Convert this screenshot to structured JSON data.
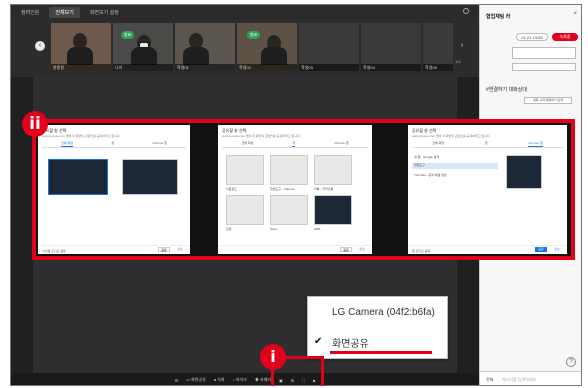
{
  "topbar": {
    "tabs": [
      "참여인원",
      "전체보기",
      "화면보기 설정"
    ],
    "active_tab_index": 1
  },
  "participants": [
    {
      "caption": "한종원",
      "badge": ""
    },
    {
      "caption": "나이",
      "badge": "발표"
    },
    {
      "caption": "학생01",
      "badge": ""
    },
    {
      "caption": "학생02",
      "badge": "발표"
    },
    {
      "caption": "학생03",
      "badge": ""
    },
    {
      "caption": "학생04",
      "badge": ""
    },
    {
      "caption": "학생05",
      "badge": ""
    }
  ],
  "strip_page": "1/4",
  "sidepanel": {
    "title": "협업채팅 라",
    "pill_time": "01:21",
    "pill_time_extra": "13:58",
    "pill_record": "녹화중",
    "section": "#연결하기 대화상대",
    "section_button": "대화 시작 대화하기 단계",
    "input_placeholder": "메시지를 입력하세요",
    "input_prefix": "전체"
  },
  "share_dialogs": [
    {
      "title": "공유할 창 선택",
      "subtitle": "www.remote.com 앱이 이 화면의 콘텐츠를 공유하려고 합니다.",
      "tabs": [
        "전체 화면",
        "창",
        "Chrome 탭"
      ],
      "active_tab": 0,
      "footer_check": "시스템 오디오 공유",
      "share_label": "공유",
      "cancel_label": "취소"
    },
    {
      "title": "공유할 창 선택",
      "subtitle": "www.remote.com 앱이 이 화면의 콘텐츠를 공유하려고 합니다.",
      "tabs": [
        "전체 화면",
        "창",
        "Chrome 탭"
      ],
      "active_tab": 1,
      "window_captions": [
        "다운로드",
        "협업도구 - Chrome",
        "카톡 - 카카오톡",
        "한글",
        "탐색기 수업",
        "Zoom",
        "OBS"
      ],
      "share_label": "공유",
      "cancel_label": "취소"
    },
    {
      "title": "공유할 창 선택",
      "subtitle": "www.remote.com 앱이 이 화면의 콘텐츠를 공유하려고 합니다.",
      "tabs": [
        "전체 화면",
        "창",
        "Chrome 탭"
      ],
      "active_tab": 2,
      "tab_list": [
        "새 탭 - Google 검색",
        "협업도구",
        "YouTube - 공식 채널 영상"
      ],
      "footer_check": "탭 오디오 공유",
      "share_label": "공유",
      "cancel_label": "취소"
    }
  ],
  "camera_menu": {
    "options": [
      "LG Camera (04f2:b6fa)",
      "화면공유"
    ],
    "selected_index": 1
  },
  "markers": {
    "first": "i",
    "second": "ii"
  },
  "colors": {
    "highlight": "#e2001a",
    "accent_green": "#2fa15a",
    "link_blue": "#1a73e8"
  }
}
